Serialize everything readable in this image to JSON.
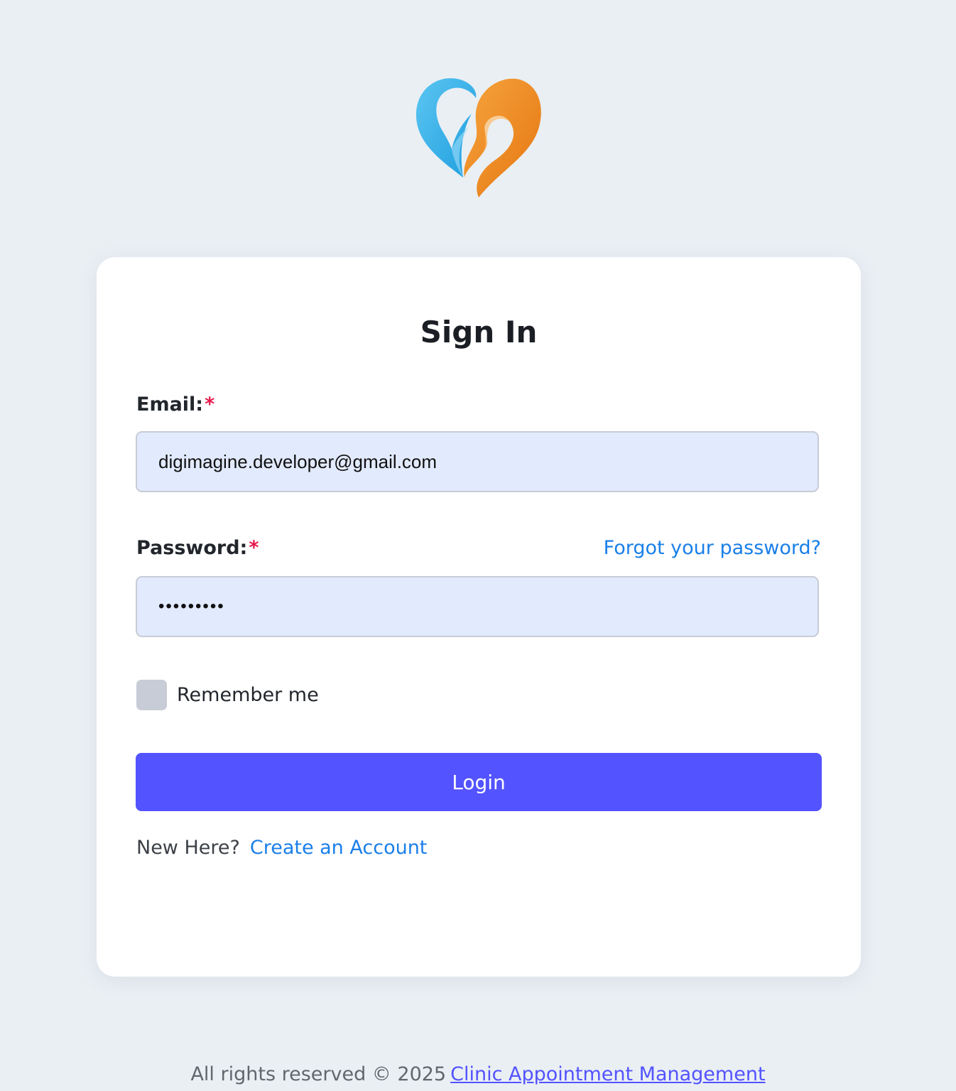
{
  "logo": {
    "icon": "heart-logo-icon",
    "colors": [
      "#37b2ea",
      "#f08a22"
    ]
  },
  "form": {
    "title": "Sign In",
    "email_label": "Email:",
    "email_value": "digimagine.developer@gmail.com",
    "password_label": "Password:",
    "password_value": "•••••••••",
    "required_marker": "*",
    "forgot_link": "Forgot your password?",
    "remember_label": "Remember me",
    "remember_checked": false,
    "login_label": "Login",
    "new_here": "New Here?",
    "create_account": "Create an Account"
  },
  "footer": {
    "text": "All rights reserved © 2025",
    "brand": "Clinic Appointment Management"
  },
  "colors": {
    "background": "#eaeff4",
    "primary": "#5353ff",
    "link": "#1a7fe8",
    "required": "#e8194a",
    "input_bg": "#e2eafd"
  }
}
